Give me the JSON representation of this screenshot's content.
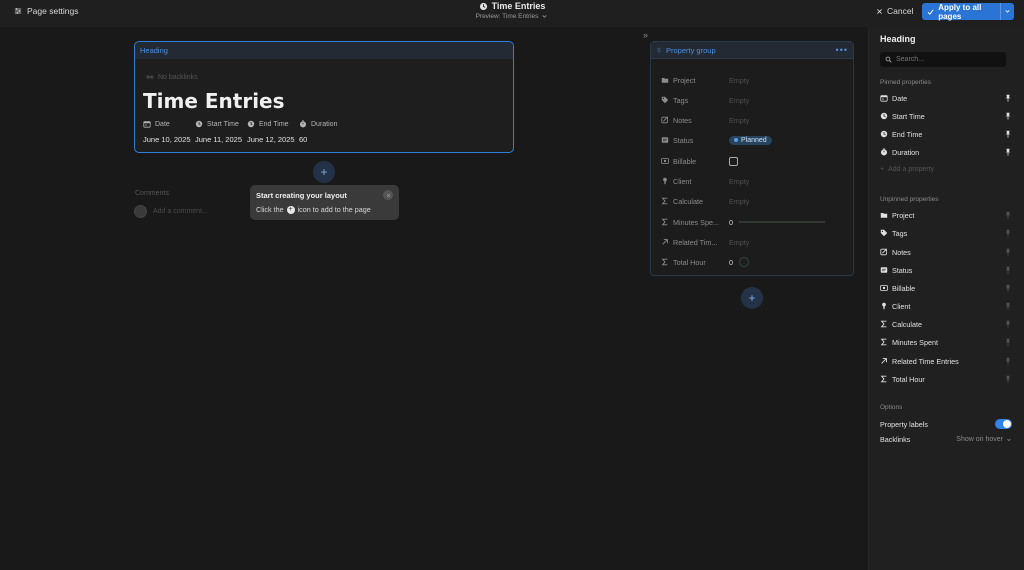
{
  "topbar": {
    "page_settings_label": "Page settings",
    "title": "Time Entries",
    "preview_label": "Preview: Time Entries",
    "cancel_label": "Cancel",
    "apply_label": "Apply to all pages"
  },
  "heading_card": {
    "tab_label": "Heading",
    "backlinks_label": "No backlinks",
    "title": "Time Entries",
    "properties": [
      {
        "label": "Date",
        "value": "June 10, 2025",
        "icon": "calendar-icon"
      },
      {
        "label": "Start Time",
        "value": "June 11, 2025",
        "icon": "clock-icon"
      },
      {
        "label": "End Time",
        "value": "June 12, 2025",
        "icon": "clock-icon"
      },
      {
        "label": "Duration",
        "value": "60",
        "icon": "timer-icon"
      }
    ]
  },
  "comments": {
    "label": "Comments",
    "placeholder": "Add a comment..."
  },
  "tooltip": {
    "title": "Start creating your layout",
    "body_before": "Click the",
    "body_after": "icon to add to the page"
  },
  "property_group": {
    "tab_label": "Property group",
    "rows": [
      {
        "label": "Project",
        "value": "Empty",
        "icon": "folder-icon"
      },
      {
        "label": "Tags",
        "value": "Empty",
        "icon": "tag-icon"
      },
      {
        "label": "Notes",
        "value": "Empty",
        "icon": "notes-icon"
      },
      {
        "label": "Status",
        "value": "Planned",
        "icon": "status-icon"
      },
      {
        "label": "Billable",
        "value": "",
        "icon": "billable-icon"
      },
      {
        "label": "Client",
        "value": "Empty",
        "icon": "person-icon"
      },
      {
        "label": "Calculate",
        "value": "Empty",
        "icon": "sigma-icon"
      },
      {
        "label": "Minutes Spe...",
        "value": "0",
        "icon": "sigma-icon",
        "progress": 0
      },
      {
        "label": "Related Tim...",
        "value": "Empty",
        "icon": "arrow-up-right-icon"
      },
      {
        "label": "Total Hour",
        "value": "0",
        "icon": "sigma-icon"
      }
    ]
  },
  "sidebar": {
    "title": "Heading",
    "search_placeholder": "Search...",
    "pinned_label": "Pinned properties",
    "pinned": [
      {
        "label": "Date",
        "icon": "calendar-icon"
      },
      {
        "label": "Start Time",
        "icon": "clock-icon"
      },
      {
        "label": "End Time",
        "icon": "clock-icon"
      },
      {
        "label": "Duration",
        "icon": "timer-icon"
      }
    ],
    "add_property_label": "Add a property",
    "unpinned_label": "Unpinned properties",
    "unpinned": [
      {
        "label": "Project",
        "icon": "folder-icon"
      },
      {
        "label": "Tags",
        "icon": "tag-icon"
      },
      {
        "label": "Notes",
        "icon": "notes-icon"
      },
      {
        "label": "Status",
        "icon": "status-icon"
      },
      {
        "label": "Billable",
        "icon": "billable-icon"
      },
      {
        "label": "Client",
        "icon": "person-icon"
      },
      {
        "label": "Calculate",
        "icon": "sigma-icon"
      },
      {
        "label": "Minutes Spent",
        "icon": "sigma-icon"
      },
      {
        "label": "Related Time Entries",
        "icon": "arrow-up-right-icon"
      },
      {
        "label": "Total Hour",
        "icon": "sigma-icon"
      }
    ],
    "options_label": "Options",
    "property_labels_label": "Property labels",
    "property_labels_on": true,
    "backlinks_label": "Backlinks",
    "backlinks_value": "Show on hover"
  },
  "colors": {
    "accent": "#2a74d6",
    "background": "#191919",
    "sidebar": "#202020",
    "status_pill": "#27445f"
  }
}
